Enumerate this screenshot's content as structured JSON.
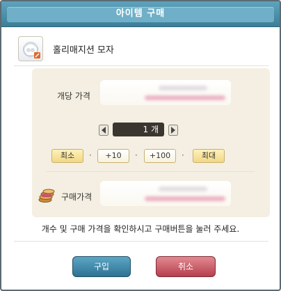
{
  "dialog": {
    "title": "아이템 구매"
  },
  "item": {
    "name": "홀리매지션 모자",
    "icon": "holy-magician-hat-icon"
  },
  "unit_price": {
    "label": "개당 가격"
  },
  "quantity": {
    "display": "1 개",
    "decrease_icon": "arrow-left-icon",
    "increase_icon": "arrow-right-icon"
  },
  "quick_buttons": {
    "min_label": "최소",
    "plus10_label": "+10",
    "plus100_label": "+100",
    "max_label": "최대",
    "separator": "·"
  },
  "total_price": {
    "label": "구매가격",
    "icon": "coins-icon"
  },
  "instruction_text": "개수 및 구매 가격을 확인하시고 구매버튼을 눌러 주세요.",
  "actions": {
    "buy_label": "구입",
    "cancel_label": "취소"
  },
  "colors": {
    "titlebar": "#4a8fa8",
    "panel": "#f4efe2",
    "buy_button": "#3e86a8",
    "cancel_button": "#c95560",
    "blur_value": "#e9a9bd"
  }
}
